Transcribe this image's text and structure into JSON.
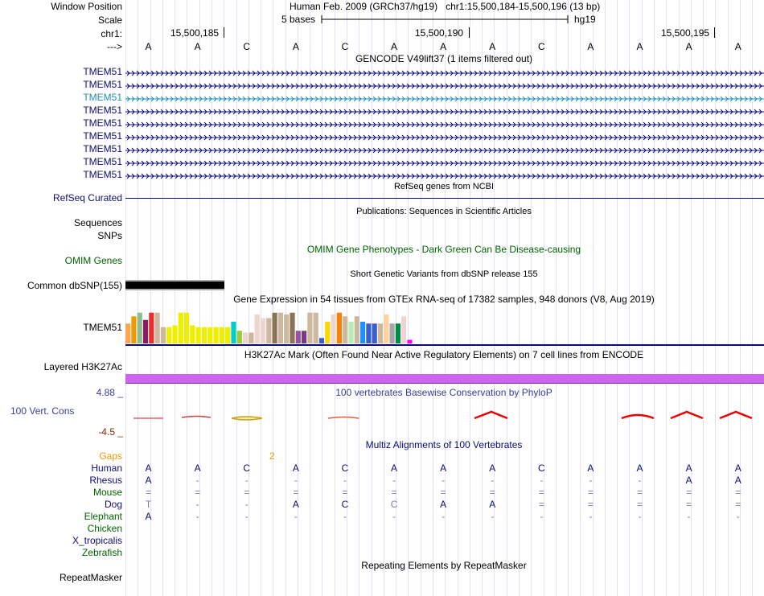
{
  "header": {
    "window_position_label": "Window Position",
    "window_position_text": "Human Feb. 2009 (GRCh37/hg19)   chr1:15,500,184-15,500,196 (13 bp)",
    "scale_label": "Scale",
    "scale_bar_text": "5 bases",
    "assembly": "hg19",
    "chrom_label": "chr1:",
    "ticks": [
      "15,500,185",
      "15,500,190",
      "15,500,195"
    ],
    "strand_label": "--->",
    "bases": [
      "A",
      "A",
      "C",
      "A",
      "C",
      "A",
      "A",
      "A",
      "C",
      "A",
      "A",
      "A",
      "A"
    ]
  },
  "gencode": {
    "title": "GENCODE V49lift37 (1 items filtered out)",
    "transcripts": [
      "TMEM51",
      "TMEM51",
      "TMEM51",
      "TMEM51",
      "TMEM51",
      "TMEM51",
      "TMEM51",
      "TMEM51",
      "TMEM51"
    ],
    "highlight_color": "#1e8fb4",
    "color": "#0c0c78"
  },
  "refseq": {
    "label": "RefSeq Curated",
    "title": "RefSeq genes from NCBI"
  },
  "publications": {
    "title": "Publications: Sequences in Scientific Articles"
  },
  "sequences": {
    "label": "Sequences"
  },
  "snps": {
    "label": "SNPs"
  },
  "omim": {
    "label": "OMIM Genes",
    "title": "OMIM Gene Phenotypes - Dark Green Can Be Disease-causing",
    "color": "#006400"
  },
  "dbsnp": {
    "label": "Common dbSNP(155)",
    "title": "Short Genetic Variants from dbSNP release 155"
  },
  "gtex": {
    "label": "TMEM51",
    "title": "Gene Expression in 54 tissues from GTEx RNA-seq of 17382 samples, 948 donors (V8, Aug 2019)",
    "bars": [
      {
        "h": 0.55,
        "c": "#ffa54f"
      },
      {
        "h": 0.75,
        "c": "#ee9a00"
      },
      {
        "h": 0.85,
        "c": "#8fbc8f"
      },
      {
        "h": 0.65,
        "c": "#8b1c62"
      },
      {
        "h": 0.85,
        "c": "#ee2c2c"
      },
      {
        "h": 0.85,
        "c": "#cdb79e"
      },
      {
        "h": 0.45,
        "c": "#cdb79e"
      },
      {
        "h": 0.45,
        "c": "#eeee00"
      },
      {
        "h": 0.5,
        "c": "#eeee00"
      },
      {
        "h": 0.85,
        "c": "#eeee00"
      },
      {
        "h": 0.85,
        "c": "#eeee00"
      },
      {
        "h": 0.5,
        "c": "#eeee00"
      },
      {
        "h": 0.45,
        "c": "#eeee00"
      },
      {
        "h": 0.45,
        "c": "#eeee00"
      },
      {
        "h": 0.45,
        "c": "#eeee00"
      },
      {
        "h": 0.45,
        "c": "#eeee00"
      },
      {
        "h": 0.45,
        "c": "#eeee00"
      },
      {
        "h": 0.45,
        "c": "#eeee00"
      },
      {
        "h": 0.6,
        "c": "#00cdcd"
      },
      {
        "h": 0.35,
        "c": "#9acd32"
      },
      {
        "h": 0.3,
        "c": "#eed5d2"
      },
      {
        "h": 0.3,
        "c": "#cdb79e"
      },
      {
        "h": 0.8,
        "c": "#eed5d2"
      },
      {
        "h": 0.7,
        "c": "#eed5d2"
      },
      {
        "h": 0.7,
        "c": "#cdb79e"
      },
      {
        "h": 0.85,
        "c": "#8b7355"
      },
      {
        "h": 0.85,
        "c": "#cdb79e"
      },
      {
        "h": 0.8,
        "c": "#cdb79e"
      },
      {
        "h": 0.85,
        "c": "#8b7355"
      },
      {
        "h": 0.35,
        "c": "#9a50a0"
      },
      {
        "h": 0.35,
        "c": "#7a378b"
      },
      {
        "h": 0.85,
        "c": "#cdb79e"
      },
      {
        "h": 0.85,
        "c": "#cdb79e"
      },
      {
        "h": 0.15,
        "c": "#3a5fcd"
      },
      {
        "h": 0.6,
        "c": "#ffd700"
      },
      {
        "h": 0.8,
        "c": "#eed5d2"
      },
      {
        "h": 0.85,
        "c": "#ff7f00"
      },
      {
        "h": 0.75,
        "c": "#cdb79e"
      },
      {
        "h": 0.6,
        "c": "#b4eeb4"
      },
      {
        "h": 0.75,
        "c": "#cdb79e"
      },
      {
        "h": 0.6,
        "c": "#1e90ff"
      },
      {
        "h": 0.55,
        "c": "#3a5fcd"
      },
      {
        "h": 0.55,
        "c": "#3a5fcd"
      },
      {
        "h": 0.55,
        "c": "#cdb79e"
      },
      {
        "h": 0.8,
        "c": "#ffd39b"
      },
      {
        "h": 0.55,
        "c": "#a6a6a6"
      },
      {
        "h": 0.55,
        "c": "#008b45"
      },
      {
        "h": 0.75,
        "c": "#eed5d2"
      },
      {
        "h": 0.1,
        "c": "#ff00ff"
      }
    ]
  },
  "h3k27ac": {
    "label": "Layered H3K27Ac",
    "title": "H3K27Ac Mark (Often Found Near Active Regulatory Elements) on 7 cell lines from ENCODE",
    "color": "#cc66ee"
  },
  "conservation": {
    "label": "100 Vert. Cons",
    "max": "4.88 _",
    "min": "-4.5 _",
    "title": "100 vertebrates Basewise Conservation by PhyloP",
    "color": "#3c3ca0",
    "min_color": "#8b2500"
  },
  "multiz": {
    "title": "Multiz Alignments of 100 Vertebrates",
    "gaps_label": "Gaps",
    "gaps_value": "2",
    "species": [
      {
        "name": "Human",
        "color": "#0c0c78",
        "bases": [
          "A",
          "A",
          "C",
          "A",
          "C",
          "A",
          "A",
          "A",
          "C",
          "A",
          "A",
          "A",
          "A"
        ]
      },
      {
        "name": "Rhesus",
        "color": "#0c0c78",
        "bases": [
          "A",
          "-",
          "-",
          "-",
          "-",
          "-",
          "-",
          "-",
          "-",
          "-",
          "-",
          "A",
          "A"
        ]
      },
      {
        "name": "Mouse",
        "color": "#006400",
        "bases": [
          "=",
          "=",
          "=",
          "=",
          "=",
          "=",
          "=",
          "=",
          "=",
          "=",
          "=",
          "=",
          "="
        ]
      },
      {
        "name": "Dog",
        "color": "#0c0c78",
        "bases": [
          "T",
          "-",
          "-",
          "A",
          "C",
          "C",
          "A",
          "A",
          "=",
          "=",
          "=",
          "=",
          "="
        ]
      },
      {
        "name": "Elephant",
        "color": "#006400",
        "bases": [
          "A",
          "-",
          "-",
          "-",
          "-",
          "-",
          "-",
          "-",
          "-",
          "-",
          "-",
          "-",
          "-"
        ]
      },
      {
        "name": "Chicken",
        "color": "#006400",
        "bases": []
      },
      {
        "name": "X_tropicalis",
        "color": "#0c0c78",
        "bases": []
      },
      {
        "name": "Zebrafish",
        "color": "#006400",
        "bases": []
      }
    ]
  },
  "repeatmasker": {
    "label": "RepeatMasker",
    "title": "Repeating Elements by RepeatMasker"
  }
}
